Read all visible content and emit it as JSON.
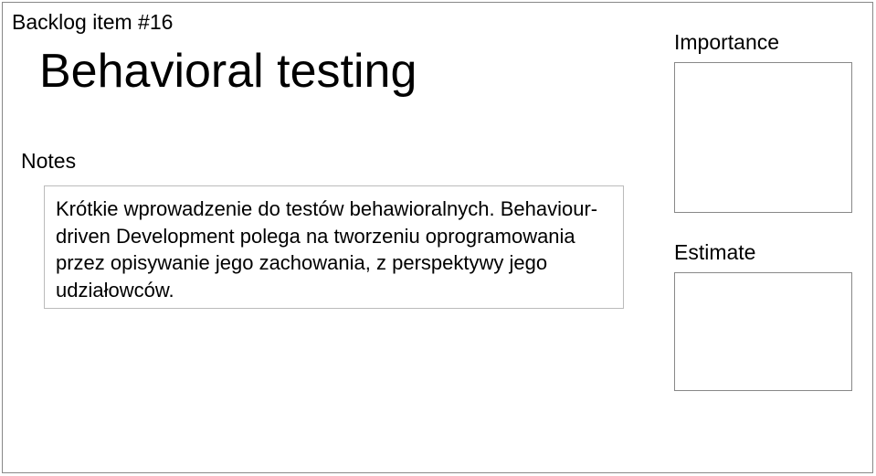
{
  "card": {
    "backlog_label": "Backlog item #16",
    "title": "Behavioral testing",
    "notes_label": "Notes",
    "notes_text": "Krótkie wprowadzenie do testów behawioralnych. Behaviour-driven Development polega na tworzeniu oprogramowania przez opisywanie jego zachowania, z perspektywy jego udziałowców.",
    "importance_label": "Importance",
    "importance_value": "",
    "estimate_label": "Estimate",
    "estimate_value": ""
  }
}
